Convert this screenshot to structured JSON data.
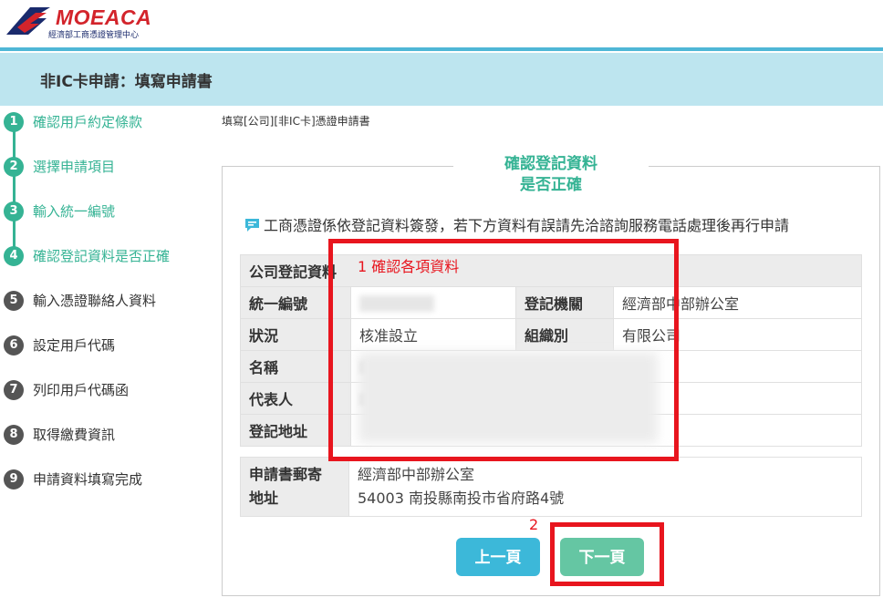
{
  "header": {
    "logo_text": "MOEACA",
    "logo_sub": "經濟部工商憑證管理中心",
    "brand_colors": {
      "red": "#d3242b",
      "navy": "#1a2a6c",
      "accent": "#4fb7d6"
    }
  },
  "titlebar": {
    "title": "非IC卡申請：填寫申請書"
  },
  "steps": [
    {
      "num": "1",
      "label": "確認用戶約定條款",
      "done": true
    },
    {
      "num": "2",
      "label": "選擇申請項目",
      "done": true
    },
    {
      "num": "3",
      "label": "輸入統一編號",
      "done": true
    },
    {
      "num": "4",
      "label": "確認登記資料是否正確",
      "done": true
    },
    {
      "num": "5",
      "label": "輸入憑證聯絡人資料",
      "done": false
    },
    {
      "num": "6",
      "label": "設定用戶代碼",
      "done": false
    },
    {
      "num": "7",
      "label": "列印用戶代碼函",
      "done": false
    },
    {
      "num": "8",
      "label": "取得繳費資訊",
      "done": false
    },
    {
      "num": "9",
      "label": "申請資料填寫完成",
      "done": false
    }
  ],
  "breadcrumb": "填寫[公司][非IC卡]憑證申請書",
  "card": {
    "title_line1": "確認登記資料",
    "title_line2": "是否正確",
    "note": "工商憑證係依登記資料簽發，若下方資料有誤請先洽諮詢服務電話處理後再行申請"
  },
  "table": {
    "section": "公司登記資料",
    "rows": {
      "tax_id_label": "統一編號",
      "registry_label": "登記機關",
      "registry_value": "經濟部中部辦公室",
      "status_label": "狀況",
      "status_value": "核准設立",
      "org_type_label": "組織別",
      "org_type_value": "有限公司",
      "name_label": "名稱",
      "rep_label": "代表人",
      "address_label": "登記地址"
    }
  },
  "mail_address": {
    "label_line1": "申請書郵寄",
    "label_line2": "地址",
    "value_line1": "經濟部中部辦公室",
    "value_line2": "54003 南投縣南投市省府路4號"
  },
  "buttons": {
    "prev": "上一頁",
    "next": "下一頁"
  },
  "annotations": {
    "ann1": "1 確認各項資料",
    "ann2": "2",
    "color": "#e8151e"
  }
}
